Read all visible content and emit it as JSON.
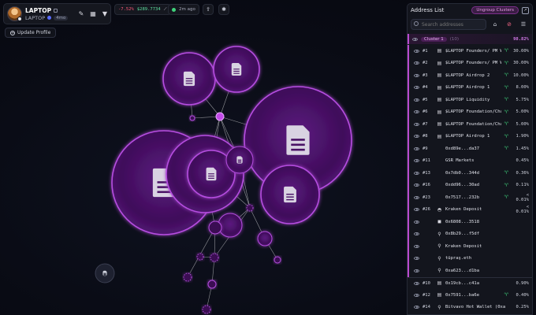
{
  "token": {
    "name": "LAPTOP",
    "ticker": "LAPTOP",
    "age": "4mo"
  },
  "update_profile_label": "Update Profile",
  "stats": {
    "change": "-7.52%",
    "price": "$289.7734",
    "updated": "2m ago"
  },
  "panel": {
    "title": "Address List",
    "ungroup_label": "Ungroup Clusters",
    "search_placeholder": "Search addresses",
    "cluster": {
      "name": "Cluster 1",
      "count": "(10)",
      "pct": "98.82%"
    },
    "rows": [
      {
        "idx": "#1",
        "icon": "doc",
        "label": "$LAPTOP Founders/ PM Wa…",
        "sprout": true,
        "pct": "30.00%",
        "group": true
      },
      {
        "idx": "#2",
        "icon": "doc",
        "label": "$LAPTOP Founders/ PM Wa…",
        "sprout": true,
        "pct": "30.00%",
        "group": true
      },
      {
        "idx": "#3",
        "icon": "doc",
        "label": "$LAPTOP Airdrop 2",
        "sprout": true,
        "pct": "10.00%",
        "group": true
      },
      {
        "idx": "#4",
        "icon": "doc",
        "label": "$LAPTOP Airdrop 1",
        "sprout": true,
        "pct": "8.00%",
        "group": true
      },
      {
        "idx": "#5",
        "icon": "doc",
        "label": "$LAPTOP Liquidity",
        "sprout": true,
        "pct": "5.75%",
        "group": true
      },
      {
        "idx": "#6",
        "icon": "doc",
        "label": "$LAPTOP Foundation/Chai…",
        "sprout": true,
        "pct": "5.00%",
        "group": true
      },
      {
        "idx": "#7",
        "icon": "doc",
        "label": "$LAPTOP Foundation/Chai…",
        "sprout": true,
        "pct": "5.00%",
        "group": true
      },
      {
        "idx": "#8",
        "icon": "doc",
        "label": "$LAPTOP Airdrop 1",
        "sprout": true,
        "pct": "1.90%",
        "group": true
      },
      {
        "idx": "#9",
        "icon": "none",
        "label": "0xd89e...da37",
        "sprout": true,
        "pct": "1.45%",
        "group": true
      },
      {
        "idx": "#11",
        "icon": "none",
        "label": "GSR Markets",
        "sprout": false,
        "pct": "0.45%",
        "group": true
      },
      {
        "idx": "#13",
        "icon": "none",
        "label": "0x7db0...344d",
        "sprout": true,
        "pct": "0.36%",
        "group": true
      },
      {
        "idx": "#16",
        "icon": "none",
        "label": "0xdd96...30ad",
        "sprout": true,
        "pct": "0.11%",
        "group": true
      },
      {
        "idx": "#23",
        "icon": "none",
        "label": "0x7517...232b",
        "sprout": true,
        "pct": "< 0.01%",
        "group": true
      },
      {
        "idx": "#26",
        "icon": "kraken",
        "label": "Kraken Deposit",
        "sprout": false,
        "pct": "< 0.01%",
        "group": true
      },
      {
        "idx": "",
        "icon": "square",
        "label": "0x6808...3518",
        "sprout": false,
        "pct": "",
        "group": true
      },
      {
        "idx": "",
        "icon": "node",
        "label": "0x8b29...f5df",
        "sprout": false,
        "pct": "",
        "group": true
      },
      {
        "idx": "",
        "icon": "node",
        "label": "Kraken Deposit",
        "sprout": false,
        "pct": "",
        "group": true
      },
      {
        "idx": "",
        "icon": "node",
        "label": "tüpraş.eth",
        "sprout": false,
        "pct": "",
        "group": true
      },
      {
        "idx": "",
        "icon": "node",
        "label": "0xa623...d1ba",
        "sprout": false,
        "pct": "",
        "group": true
      },
      {
        "idx": "#10",
        "icon": "doc",
        "label": "0x19cb...c41a",
        "sprout": false,
        "pct": "0.90%",
        "group": false
      },
      {
        "idx": "#12",
        "icon": "doc",
        "label": "0x7591...ba6e",
        "sprout": true,
        "pct": "0.40%",
        "group": false
      },
      {
        "idx": "#14",
        "icon": "node",
        "label": "Bitvavo Hot Wallet (0xaB…",
        "sprout": false,
        "pct": "0.25%",
        "group": false
      }
    ]
  },
  "colors": {
    "accent": "#b94ad0",
    "bubble_fill": "#4a1266",
    "bubble_stroke": "#b64ee0",
    "positive": "#3fd27b",
    "negative": "#ff5b7a"
  }
}
